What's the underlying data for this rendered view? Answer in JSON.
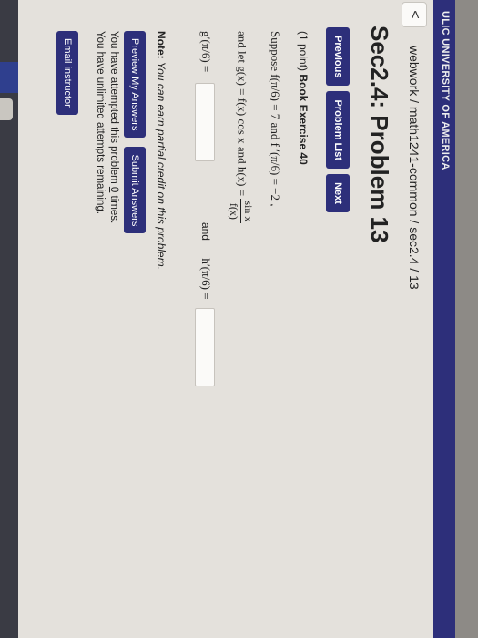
{
  "header": {
    "institution_text": "ULIC UNIVERSITY OF AMERICA"
  },
  "breadcrumb": {
    "back_symbol": "<",
    "path": "webwork / math1241-common / sec2.4 / 13"
  },
  "page_title": "Sec2.4: Problem 13",
  "nav": {
    "previous": "Previous",
    "problem_list": "Problem List",
    "next": "Next"
  },
  "problem": {
    "points_prefix": "(1 point) ",
    "book_ref": "Book Exercise 40",
    "given_line": "Suppose f(π/6) = 7  and f ′(π/6) = −2 ,",
    "define_line_start": "and let g(x) = f(x) cos x  and h(x) = ",
    "frac_num": "sin x",
    "frac_den": "f(x)",
    "g_prime_label": "g′(π/6) =",
    "and_label": "and",
    "h_prime_label": "h′(π/6) ="
  },
  "note": {
    "label": "Note:",
    "text": " You can earn partial credit on this problem."
  },
  "actions": {
    "preview": "Preview My Answers",
    "submit": "Submit Answers"
  },
  "status": {
    "attempts_prefix": "You have attempted this problem ",
    "attempts_count": "0",
    "attempts_suffix": " times.",
    "remaining": "You have unlimited attempts remaining."
  },
  "email_instructor": "Email instructor",
  "colors": {
    "brand": "#2d2f7a",
    "page_bg": "#e4e1dc"
  }
}
